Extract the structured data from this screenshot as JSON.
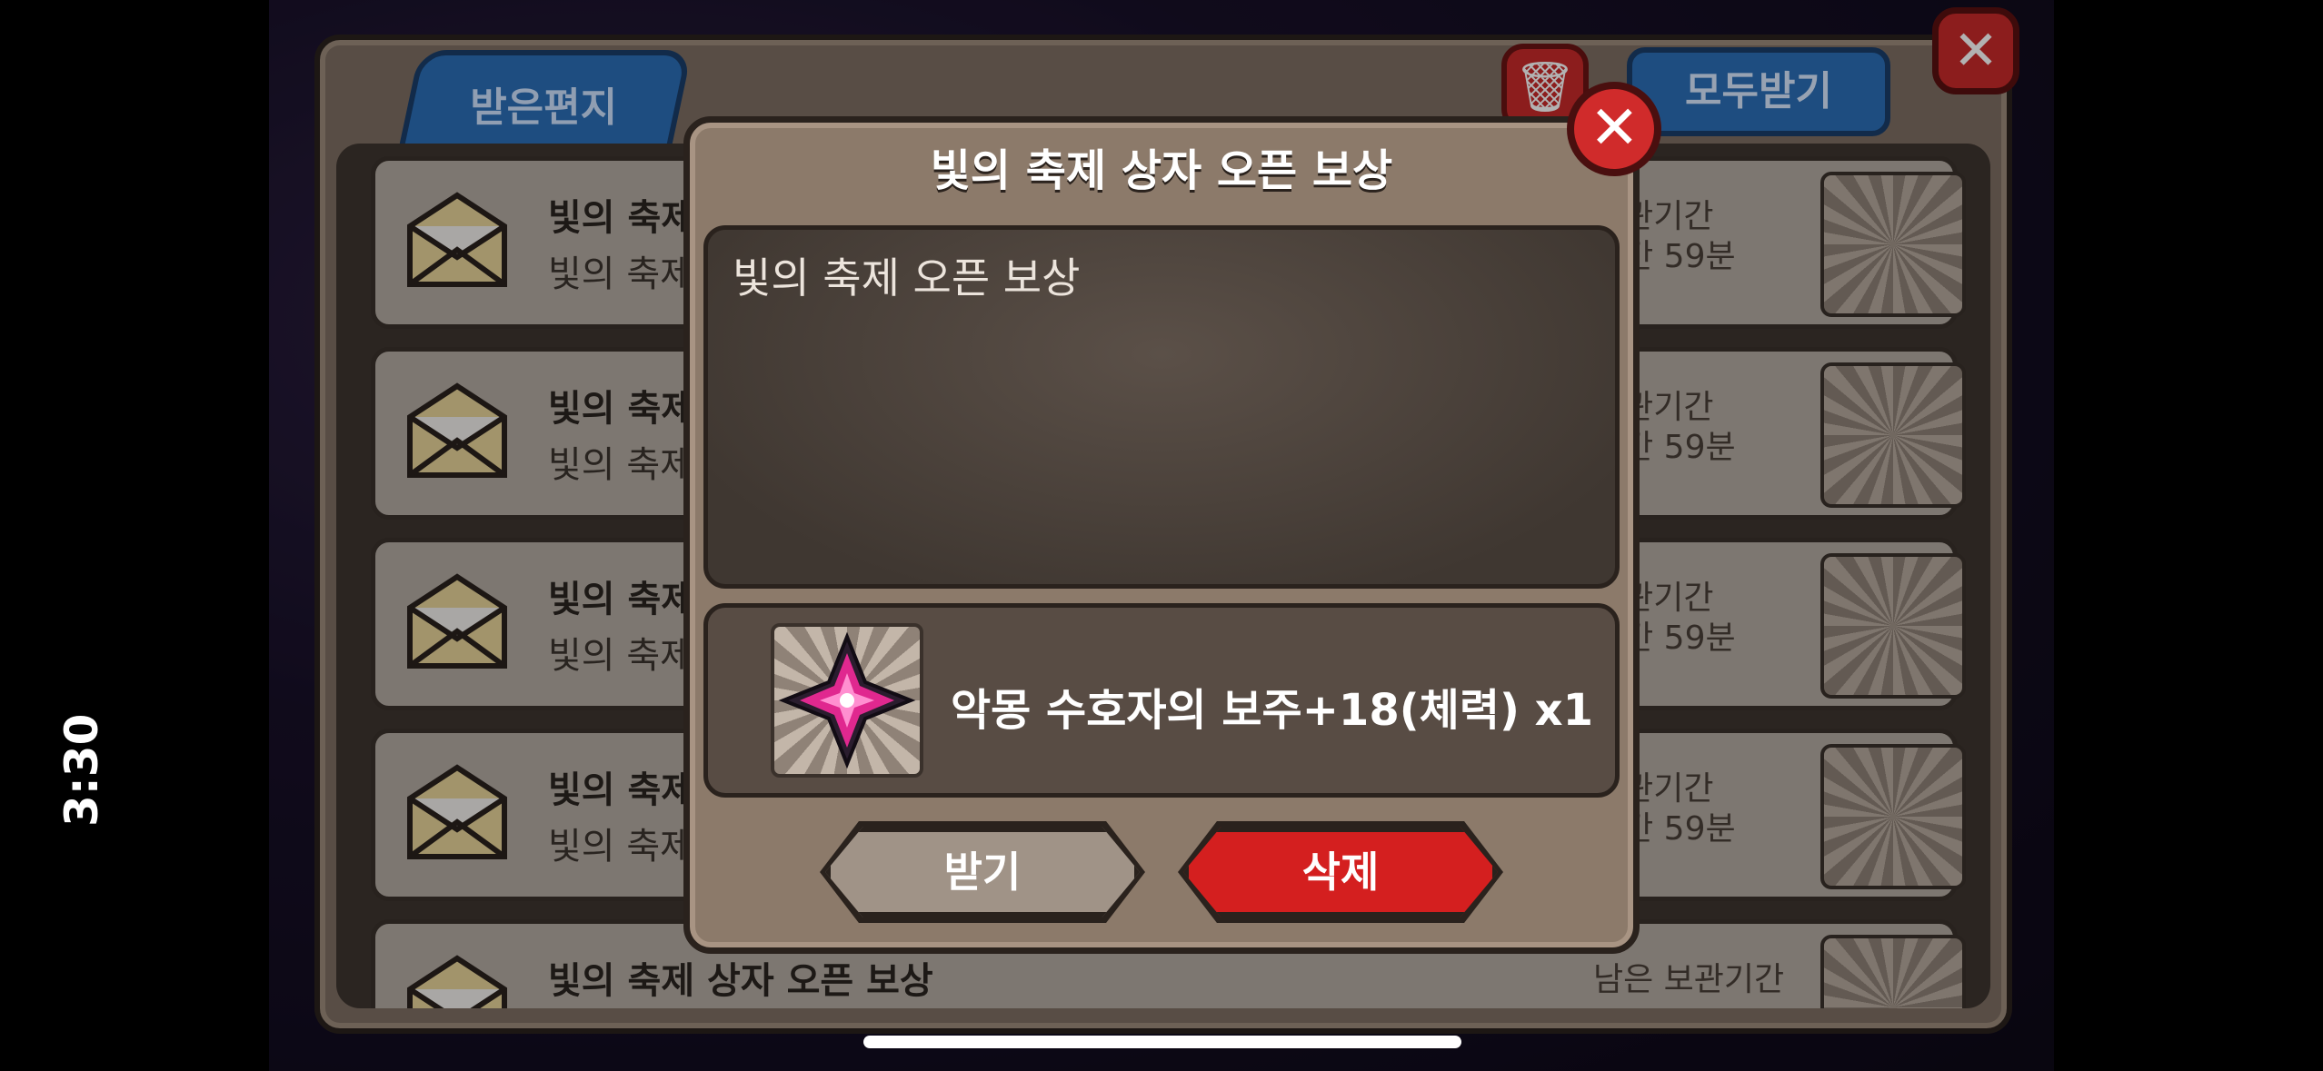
{
  "status_bar": {
    "time": "3:30"
  },
  "mailbox": {
    "tab_label": "받은편지",
    "receive_all_label": "모두받기",
    "items": [
      {
        "title": "빛의 축제",
        "subtitle": "빛의 축제",
        "remaining_label": "보관기간",
        "remaining_time": "시간 59분"
      },
      {
        "title": "빛의 축제",
        "subtitle": "빛의 축제",
        "remaining_label": "보관기간",
        "remaining_time": "시간 59분"
      },
      {
        "title": "빛의 축제",
        "subtitle": "빛의 축제",
        "remaining_label": "보관기간",
        "remaining_time": "시간 59분"
      },
      {
        "title": "빛의 축제",
        "subtitle": "빛의 축제",
        "remaining_label": "보관기간",
        "remaining_time": "시간 59분"
      },
      {
        "title": "빛의 축제 상자 오픈 보상",
        "subtitle": "",
        "remaining_label": "남은 보관기간",
        "remaining_time": ""
      }
    ]
  },
  "popup": {
    "title": "빛의 축제 상자 오픈 보상",
    "message": "빛의 축제 오픈 보상",
    "reward_text": "악몽 수호자의 보주+18(체력) x1",
    "receive_label": "받기",
    "delete_label": "삭제"
  },
  "colors": {
    "accent_blue": "#2b6fb8",
    "danger_red": "#d41f1f",
    "panel_brown": "#8c7a6a"
  }
}
